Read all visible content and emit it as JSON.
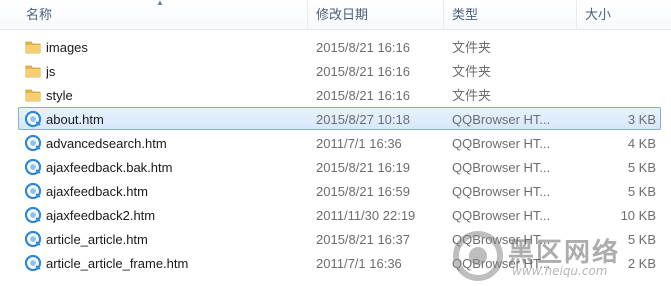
{
  "columns": {
    "name": "名称",
    "modified": "修改日期",
    "type": "类型",
    "size": "大小"
  },
  "files": [
    {
      "name": "images",
      "modified": "2015/8/21 16:16",
      "type": "文件夹",
      "size": "",
      "icon": "folder-icon",
      "selected": false
    },
    {
      "name": "js",
      "modified": "2015/8/21 16:16",
      "type": "文件夹",
      "size": "",
      "icon": "folder-icon",
      "selected": false
    },
    {
      "name": "style",
      "modified": "2015/8/21 16:16",
      "type": "文件夹",
      "size": "",
      "icon": "folder-icon",
      "selected": false
    },
    {
      "name": "about.htm",
      "modified": "2015/8/27 10:18",
      "type": "QQBrowser HT...",
      "size": "3 KB",
      "icon": "qqbrowser-html-icon",
      "selected": true
    },
    {
      "name": "advancedsearch.htm",
      "modified": "2011/7/1 16:36",
      "type": "QQBrowser HT...",
      "size": "4 KB",
      "icon": "qqbrowser-html-icon",
      "selected": false
    },
    {
      "name": "ajaxfeedback.bak.htm",
      "modified": "2015/8/21 16:19",
      "type": "QQBrowser HT...",
      "size": "5 KB",
      "icon": "qqbrowser-html-icon",
      "selected": false
    },
    {
      "name": "ajaxfeedback.htm",
      "modified": "2015/8/21 16:59",
      "type": "QQBrowser HT...",
      "size": "5 KB",
      "icon": "qqbrowser-html-icon",
      "selected": false
    },
    {
      "name": "ajaxfeedback2.htm",
      "modified": "2011/11/30 22:19",
      "type": "QQBrowser HT...",
      "size": "10 KB",
      "icon": "qqbrowser-html-icon",
      "selected": false
    },
    {
      "name": "article_article.htm",
      "modified": "2015/8/21 16:37",
      "type": "QQBrowser HT...",
      "size": "5 KB",
      "icon": "qqbrowser-html-icon",
      "selected": false
    },
    {
      "name": "article_article_frame.htm",
      "modified": "2011/7/1 16:36",
      "type": "QQBrowser HT...",
      "size": "2 KB",
      "icon": "qqbrowser-html-icon",
      "selected": false
    }
  ],
  "watermark": {
    "text": "黑区网络",
    "url": "www.heiqu.com"
  },
  "colors": {
    "selection_fill": "#dcebfc",
    "selection_border": "#84acdd",
    "folder": "#e8b94a",
    "header_text": "#4c607a",
    "secondary_text": "#6d6d6d"
  }
}
